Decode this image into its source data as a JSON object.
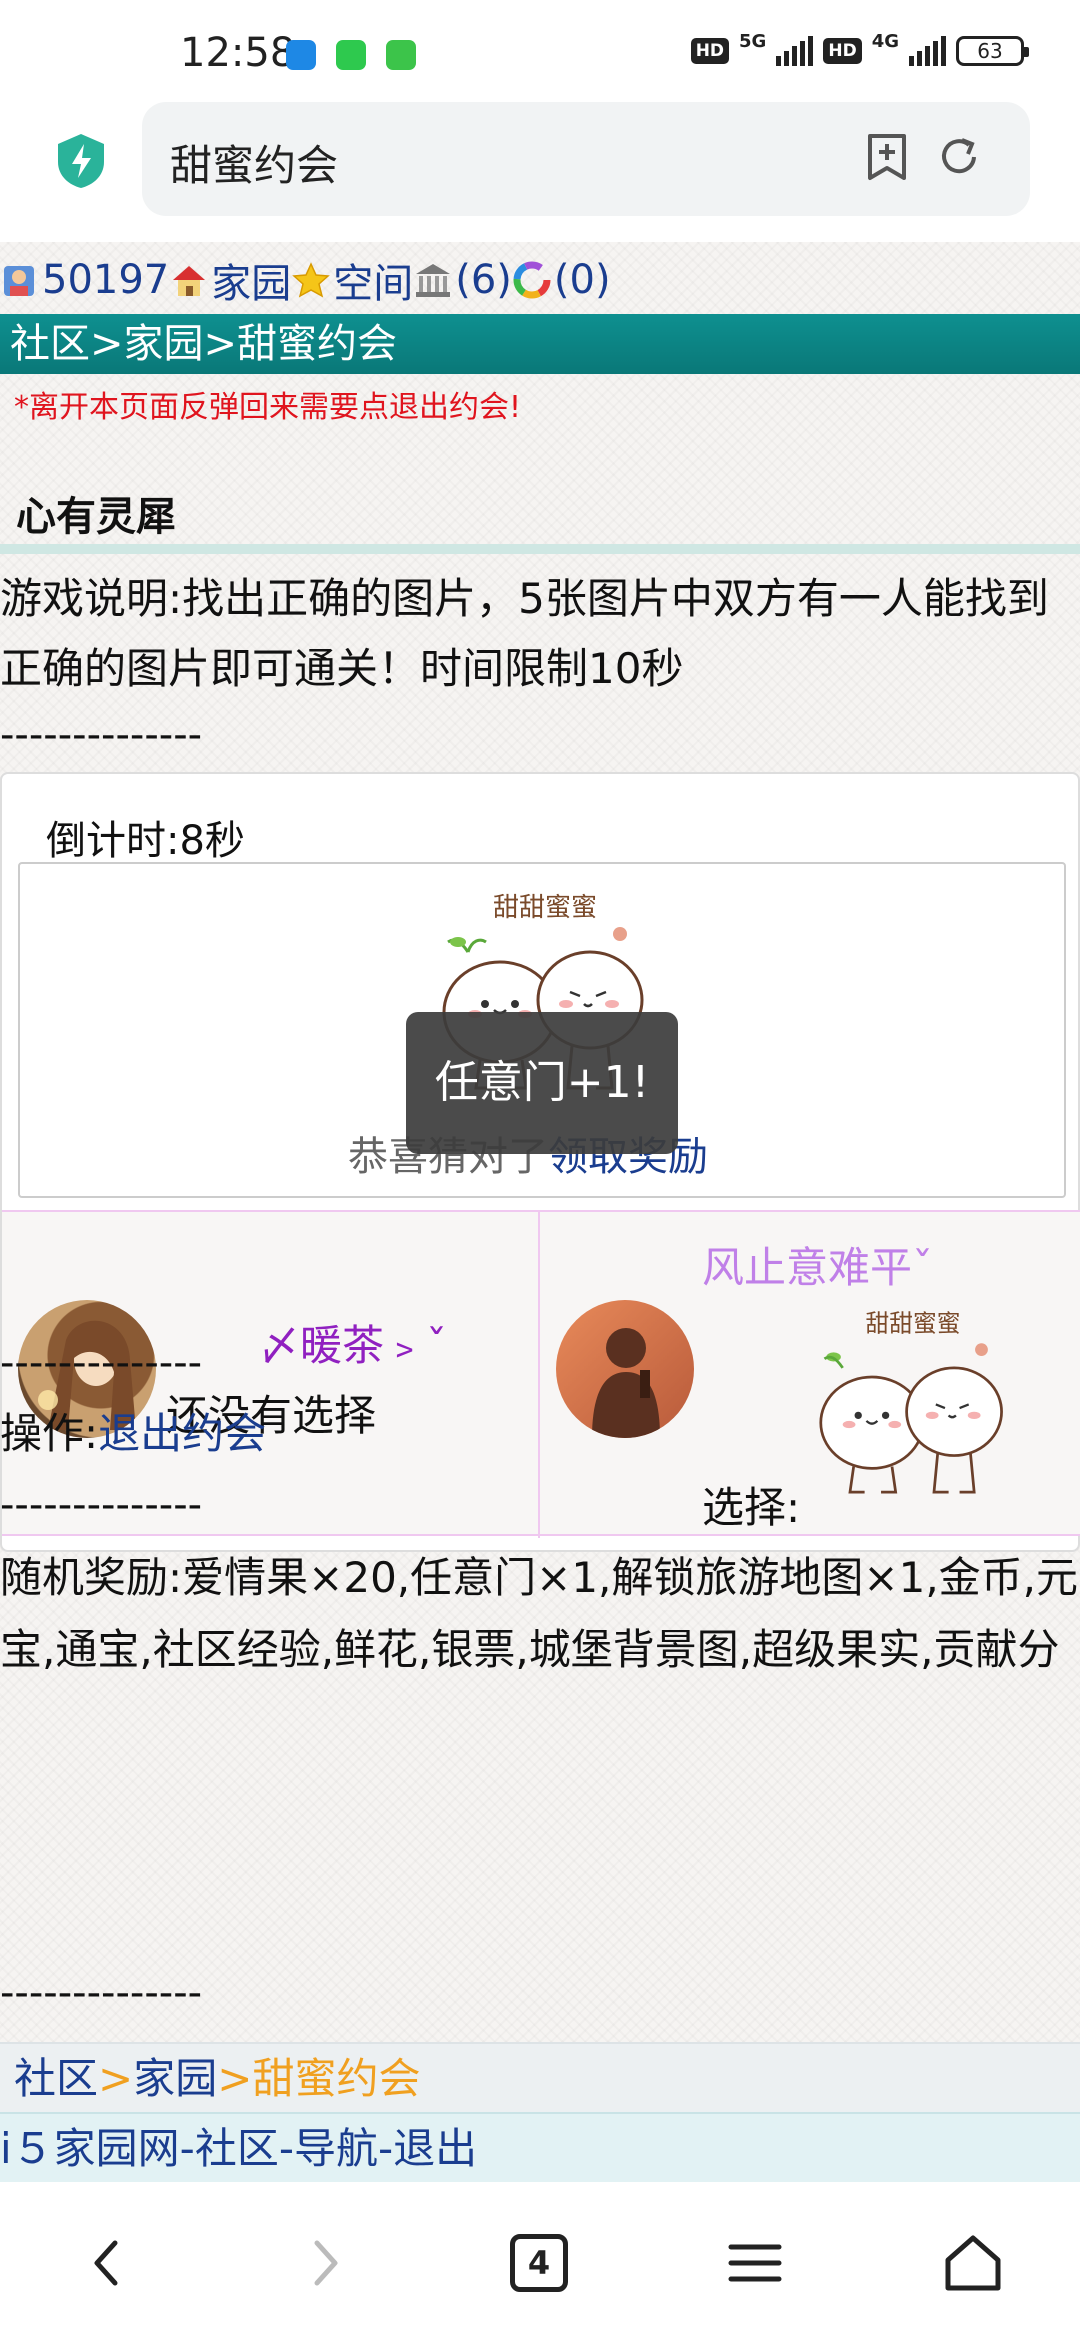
{
  "status_bar": {
    "time": "12:58",
    "net_1": "5G",
    "net_2": "4G",
    "hd": "HD",
    "battery": "63"
  },
  "browser": {
    "url_text": "甜蜜约会",
    "icons": [
      "shield-icon",
      "bookmark-add-icon",
      "refresh-icon"
    ]
  },
  "user_bar": {
    "user_id": "50197",
    "home_label": "家园",
    "space_label": "空间",
    "bank_count": "(6)",
    "wheel_count": "(0)"
  },
  "breadcrumb": "社区>家园>甜蜜约会",
  "notice": "*离开本页面反弹回来需要点退出约会!",
  "section_title": "心有灵犀",
  "description": "游戏说明:找出正确的图片，5张图片中双方有一人能找到正确的图片即可通关！时间限制10秒",
  "dashes": "--------------",
  "game": {
    "countdown": "倒计时:8秒",
    "image_caption": "甜甜蜜蜜",
    "result_text": "恭喜猜对了",
    "claim_link": "领取奖励"
  },
  "players": {
    "left": {
      "name": "〆暖茶﹥ˇ",
      "status": "还没有选择"
    },
    "right": {
      "name": "风止意难平ˇ",
      "status": "选择:",
      "choice_caption": "甜甜蜜蜜"
    }
  },
  "toast": "任意门+1!",
  "operation": {
    "label": "操作:",
    "link": "退出约会"
  },
  "rewards": "随机奖励:爱情果×20,任意门×1,解锁旅游地图×1,金币,元宝,通宝,社区经验,鲜花,银票,城堡背景图,超级果实,贡献分",
  "footer_crumb": {
    "community": "社区",
    "sep": ">",
    "home": "家园",
    "current": "甜蜜约会"
  },
  "footer_links": {
    "site": "i５家园网",
    "community": "社区",
    "nav": "导航",
    "logout": "退出",
    "sep": "-"
  },
  "bottom_nav": {
    "tab_count": "4",
    "icons": [
      "back-icon",
      "forward-icon",
      "tabs-icon",
      "menu-icon",
      "home-icon"
    ]
  },
  "colors": {
    "crumb_bar": "#0e9090",
    "link": "#1a3d8f",
    "notice": "#e0141e",
    "player_name": "#9020c0"
  }
}
